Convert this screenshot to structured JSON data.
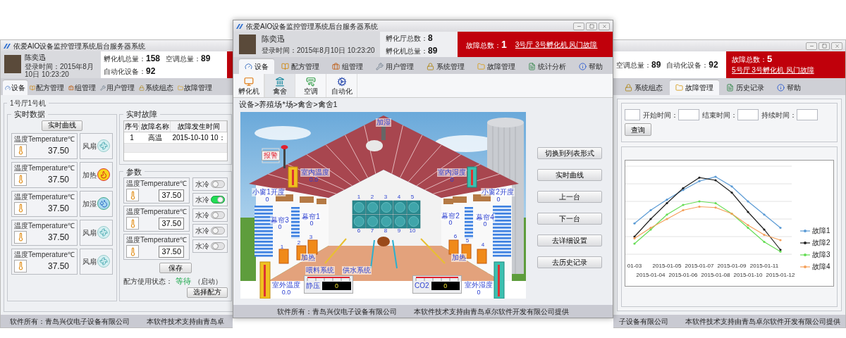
{
  "left_window": {
    "title": "依爱AIO设备监控管理系统后台服务器系统",
    "user": {
      "name": "陈奕迅",
      "login": "登录时间：2015年8月10日 10:23:20"
    },
    "stats": [
      {
        "label": "孵化机总量：",
        "value": "158"
      },
      {
        "label": "空调总量：",
        "value": "89"
      },
      {
        "label": "自动化设备：",
        "value": "92"
      }
    ],
    "tabs": [
      {
        "label": "设备",
        "selected": true
      },
      {
        "label": "配方管理",
        "selected": false
      },
      {
        "label": "组管理",
        "selected": false
      },
      {
        "label": "用户管理",
        "selected": false
      },
      {
        "label": "系统组态",
        "selected": false
      },
      {
        "label": "故障管理",
        "selected": false
      }
    ],
    "group_title": "1号厅1号机",
    "realtime": {
      "title": "实时数据",
      "button": "实时曲线",
      "rows": [
        {
          "sensor": "温度Temperature",
          "unit": "℃",
          "value": "37.50",
          "device": "风扇",
          "kind": "fan"
        },
        {
          "sensor": "温度Temperature",
          "unit": "℃",
          "value": "37.50",
          "device": "加热",
          "kind": "heat"
        },
        {
          "sensor": "温度Temperature",
          "unit": "℃",
          "value": "37.50",
          "device": "加湿",
          "kind": "humidify"
        },
        {
          "sensor": "温度Temperature",
          "unit": "℃",
          "value": "37.50",
          "device": "风扇",
          "kind": "fan"
        },
        {
          "sensor": "温度Temperature",
          "unit": "℃",
          "value": "37.50",
          "device": "风扇",
          "kind": "fan"
        }
      ]
    },
    "faults": {
      "title": "实时故障",
      "columns": [
        "序号",
        "故障名称",
        "故障发生时间"
      ],
      "rows": [
        [
          "1",
          "高温",
          "2015-10-10 10："
        ]
      ]
    },
    "params": {
      "title": "参数",
      "sensors": [
        {
          "sensor": "温度Temperature",
          "unit": "℃",
          "value": "37.50"
        },
        {
          "sensor": "温度Temperature",
          "unit": "℃",
          "value": "37.50"
        },
        {
          "sensor": "温度Temperature",
          "unit": "℃",
          "value": "37.50"
        }
      ],
      "switches": [
        {
          "label": "水冷",
          "on": false
        },
        {
          "label": "水冷",
          "on": true
        },
        {
          "label": "水冷",
          "on": false
        },
        {
          "label": "水冷",
          "on": false
        },
        {
          "label": "水冷",
          "on": false
        }
      ],
      "save": "保存",
      "status_label": "配方使用状态：",
      "status": "等待",
      "status_note": "（启动）",
      "choose": "选择配方"
    },
    "footer": [
      "软件所有：青岛兴仪电子设备有限公司",
      "本软件技术支持由青岛卓"
    ]
  },
  "main_window": {
    "title": "依爱AIO设备监控管理系统后台服务器系统",
    "user": {
      "name": "陈奕迅",
      "login": "登录时间：2015年8月10日 10:23:20"
    },
    "stats": [
      {
        "label": "孵化厅总数：",
        "value": "8"
      },
      {
        "label": "孵化机总量：",
        "value": "89"
      }
    ],
    "alert": {
      "label": "故障总数：",
      "value": "1",
      "link": "3号厅 3号孵化机 风门故障"
    },
    "tabs": [
      {
        "label": "设备",
        "selected": true
      },
      {
        "label": "配方管理",
        "selected": false
      },
      {
        "label": "组管理",
        "selected": false
      },
      {
        "label": "用户管理",
        "selected": false
      },
      {
        "label": "系统管理",
        "selected": false
      },
      {
        "label": "故障管理",
        "selected": false
      },
      {
        "label": "统计分析",
        "selected": false
      },
      {
        "label": "帮助",
        "selected": false
      }
    ],
    "ribbon": [
      {
        "label": "孵化机",
        "selected": false
      },
      {
        "label": "禽舍",
        "selected": true
      },
      {
        "label": "空调",
        "selected": false
      },
      {
        "label": "自动化",
        "selected": false
      }
    ],
    "breadcrumb": "设备>养殖场*场>禽舍>禽舍1",
    "scene": {
      "labels": [
        {
          "text": "加湿",
          "kind": "label"
        },
        {
          "text": "报警",
          "kind": "alarm"
        },
        {
          "text": "室内温度",
          "kind": "label"
        },
        {
          "text": "0.0",
          "kind": "value"
        },
        {
          "text": "室内湿度",
          "kind": "label"
        },
        {
          "text": "0",
          "kind": "value"
        },
        {
          "text": "小窗1开度",
          "kind": "label"
        },
        {
          "text": "0",
          "kind": "value"
        },
        {
          "text": "小窗2开度",
          "kind": "label"
        },
        {
          "text": "0",
          "kind": "value"
        },
        {
          "text": "1",
          "kind": "number"
        },
        {
          "text": "2",
          "kind": "number"
        },
        {
          "text": "3",
          "kind": "number"
        },
        {
          "text": "4",
          "kind": "number"
        },
        {
          "text": "5",
          "kind": "number"
        },
        {
          "text": "6",
          "kind": "number"
        },
        {
          "text": "7",
          "kind": "number"
        },
        {
          "text": "8",
          "kind": "number"
        },
        {
          "text": "9",
          "kind": "number"
        },
        {
          "text": "10",
          "kind": "number"
        },
        {
          "text": "幕帘3",
          "kind": "label"
        },
        {
          "text": "0",
          "kind": "value"
        },
        {
          "text": "幕帘1",
          "kind": "label"
        },
        {
          "text": "0",
          "kind": "value"
        },
        {
          "text": "幕帘2",
          "kind": "label"
        },
        {
          "text": "0",
          "kind": "value"
        },
        {
          "text": "幕帘4",
          "kind": "label"
        },
        {
          "text": "0",
          "kind": "value"
        },
        {
          "text": "1",
          "kind": "number"
        },
        {
          "text": "2",
          "kind": "number"
        },
        {
          "text": "3",
          "kind": "number"
        },
        {
          "text": "6",
          "kind": "number"
        },
        {
          "text": "5",
          "kind": "number"
        },
        {
          "text": "4",
          "kind": "number"
        },
        {
          "text": "加热",
          "kind": "label"
        },
        {
          "text": "加热",
          "kind": "label"
        },
        {
          "text": "喂料系统",
          "kind": "label"
        },
        {
          "text": "供水系统",
          "kind": "label"
        },
        {
          "text": "室外温度",
          "kind": "label"
        },
        {
          "text": "0.0",
          "kind": "value"
        },
        {
          "text": "室外湿度",
          "kind": "label"
        },
        {
          "text": "0",
          "kind": "value"
        }
      ],
      "gauges": [
        {
          "name": "静压",
          "value": "0"
        },
        {
          "name": "CO2",
          "value": "0"
        }
      ]
    },
    "actions": [
      "切换到列表形式",
      "实时曲线",
      "上一台",
      "下一台",
      "去详细设置",
      "去历史记录"
    ],
    "footer": [
      "软件所有：青岛兴仪电子设备有限公司",
      "本软件技术支持由青岛卓尔软件开发有限公司提供"
    ]
  },
  "right_window": {
    "stats": [
      {
        "label": "空调总量：",
        "value": "89"
      },
      {
        "label": "自动化设备：",
        "value": "92"
      }
    ],
    "alert": {
      "label": "故障总数：",
      "value": "5",
      "link": "5号厅 3号孵化机 风门故障"
    },
    "tabs": [
      {
        "label": "系统组态",
        "selected": false
      },
      {
        "label": "故障管理",
        "selected": true
      },
      {
        "label": "历史记录",
        "selected": false
      },
      {
        "label": "帮助",
        "selected": false
      }
    ],
    "query": {
      "fields": [
        "开始时间：",
        "结束时间：",
        "持续时间："
      ],
      "button": "查询"
    },
    "chart": {
      "x_labels_top": [
        "01-03",
        "2015-01-05",
        "2015-01-07",
        "2015-01-09",
        "2015-01-11"
      ],
      "x_labels_bottom": [
        "2015-01-04",
        "2015-01-06",
        "2015-01-08",
        "2015-01-10",
        "2015-01-12"
      ],
      "legend": [
        {
          "name": "故障1",
          "color": "#5b9bd5"
        },
        {
          "name": "故障2",
          "color": "#222222"
        },
        {
          "name": "故障3",
          "color": "#66dd55"
        },
        {
          "name": "故障4",
          "color": "#f5a05a"
        }
      ]
    },
    "footer": [
      "子设备有限公司",
      "本软件技术支持由青岛卓尔软件开发有限公司提供"
    ]
  }
}
